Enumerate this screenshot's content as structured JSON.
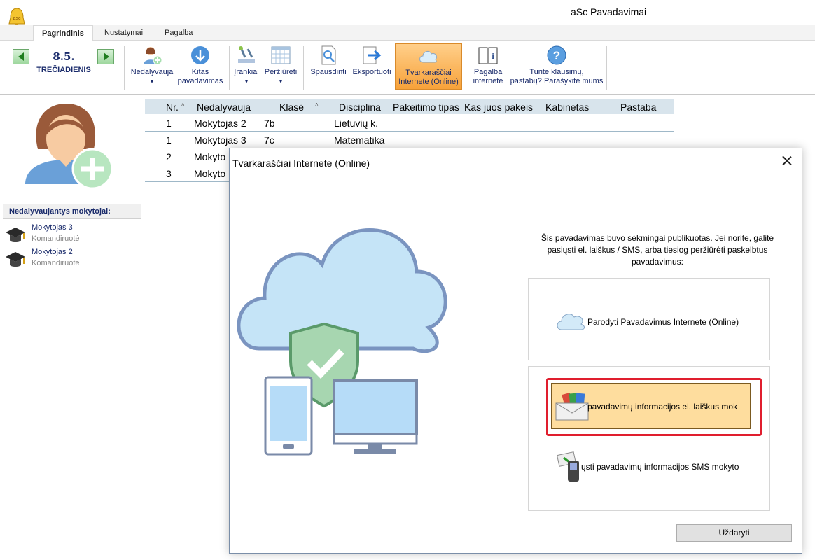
{
  "window": {
    "title": "aSc Pavadavimai",
    "app_icon": "bell-icon"
  },
  "menu_tabs": [
    {
      "label": "Pagrindinis",
      "active": true
    },
    {
      "label": "Nustatymai",
      "active": false
    },
    {
      "label": "Pagalba",
      "active": false
    }
  ],
  "ribbon": {
    "day_number": "8.5.",
    "day_name": "TREČIADIENIS",
    "buttons": {
      "absent": {
        "label": "Nedalyvauja",
        "dropdown": "▾"
      },
      "next_sub": {
        "label_line1": "Kitas",
        "label_line2": "pavadavimas"
      },
      "tools": {
        "label": "Įrankiai",
        "dropdown": "▾"
      },
      "view": {
        "label": "Peržiūrėti",
        "dropdown": "▾"
      },
      "print": {
        "label": "Spausdinti"
      },
      "export": {
        "label": "Eksportuoti"
      },
      "online": {
        "label_line1": "Tvarkaraščiai",
        "label_line2": "Internete (Online)"
      },
      "help_online": {
        "label_line1": "Pagalba",
        "label_line2": "internete"
      },
      "questions": {
        "label_line1": "Turite klausimų,",
        "label_line2": "pastabų? Parašykite mums"
      }
    }
  },
  "left_panel": {
    "absent_header": "Nedalyvaujantys mokytojai:",
    "absent_teachers": [
      {
        "name": "Mokytojas 3",
        "reason": "Komandiruotė"
      },
      {
        "name": "Mokytojas 2",
        "reason": "Komandiruotė"
      }
    ]
  },
  "table": {
    "headers": {
      "nr": "Nr.",
      "absent": "Nedalyvauja",
      "class": "Klasė",
      "discipline": "Disciplina",
      "change_type": "Pakeitimo tipas",
      "replacer": "Kas juos pakeis",
      "room": "Kabinetas",
      "note": "Pastaba"
    },
    "sort_mark": "˄",
    "rows": [
      {
        "nr": "1",
        "absent": "Mokytojas 2",
        "class": "7b",
        "discipline": "Lietuvių k."
      },
      {
        "nr": "1",
        "absent": "Mokytojas 3",
        "class": "7c",
        "discipline": "Matematika"
      },
      {
        "nr": "2",
        "absent": "Mokyto",
        "class": "",
        "discipline": ""
      },
      {
        "nr": "3",
        "absent": "Mokyto",
        "class": "",
        "discipline": ""
      }
    ]
  },
  "dialog": {
    "title": "Tvarkaraščiai Internete (Online)",
    "message": "Šis pavadavimas buvo sėkmingai publikuotas. Jei norite, galite pasiųsti el. laiškus / SMS, arba tiesiog peržiūrėti paskelbtus pavadavimus:",
    "show_online_label": "Parodyti Pavadavimus Internete (Online)",
    "email_label": "pavadavimų informacijos el. laiškus mok",
    "sms_label": "ųsti pavadavimų informacijos SMS mokyto",
    "close_label": "Uždaryti"
  },
  "colors": {
    "accent_navy": "#1a2b6b",
    "highlight_orange": "#f7a23a",
    "email_button_bg": "#fedd9e",
    "red_outline": "#e01e2e",
    "cloud_blue": "#c5e4f7",
    "shield_green": "#8bc79a"
  }
}
